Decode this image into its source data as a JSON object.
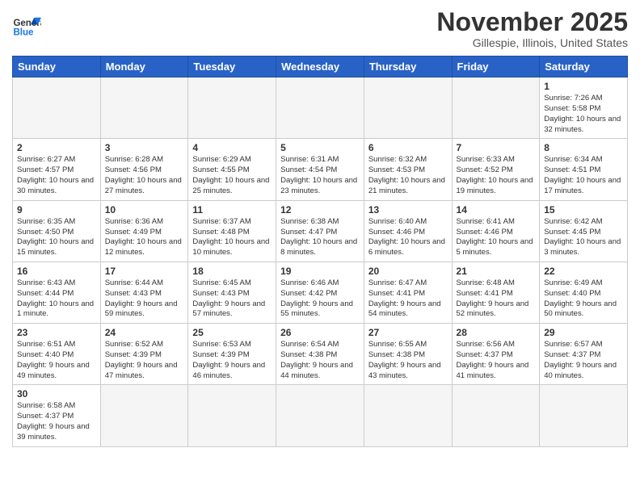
{
  "logo": {
    "text_general": "General",
    "text_blue": "Blue"
  },
  "title": "November 2025",
  "location": "Gillespie, Illinois, United States",
  "days_of_week": [
    "Sunday",
    "Monday",
    "Tuesday",
    "Wednesday",
    "Thursday",
    "Friday",
    "Saturday"
  ],
  "weeks": [
    [
      {
        "day": "",
        "info": ""
      },
      {
        "day": "",
        "info": ""
      },
      {
        "day": "",
        "info": ""
      },
      {
        "day": "",
        "info": ""
      },
      {
        "day": "",
        "info": ""
      },
      {
        "day": "",
        "info": ""
      },
      {
        "day": "1",
        "info": "Sunrise: 7:26 AM\nSunset: 5:58 PM\nDaylight: 10 hours and 32 minutes."
      }
    ],
    [
      {
        "day": "2",
        "info": "Sunrise: 6:27 AM\nSunset: 4:57 PM\nDaylight: 10 hours and 30 minutes."
      },
      {
        "day": "3",
        "info": "Sunrise: 6:28 AM\nSunset: 4:56 PM\nDaylight: 10 hours and 27 minutes."
      },
      {
        "day": "4",
        "info": "Sunrise: 6:29 AM\nSunset: 4:55 PM\nDaylight: 10 hours and 25 minutes."
      },
      {
        "day": "5",
        "info": "Sunrise: 6:31 AM\nSunset: 4:54 PM\nDaylight: 10 hours and 23 minutes."
      },
      {
        "day": "6",
        "info": "Sunrise: 6:32 AM\nSunset: 4:53 PM\nDaylight: 10 hours and 21 minutes."
      },
      {
        "day": "7",
        "info": "Sunrise: 6:33 AM\nSunset: 4:52 PM\nDaylight: 10 hours and 19 minutes."
      },
      {
        "day": "8",
        "info": "Sunrise: 6:34 AM\nSunset: 4:51 PM\nDaylight: 10 hours and 17 minutes."
      }
    ],
    [
      {
        "day": "9",
        "info": "Sunrise: 6:35 AM\nSunset: 4:50 PM\nDaylight: 10 hours and 15 minutes."
      },
      {
        "day": "10",
        "info": "Sunrise: 6:36 AM\nSunset: 4:49 PM\nDaylight: 10 hours and 12 minutes."
      },
      {
        "day": "11",
        "info": "Sunrise: 6:37 AM\nSunset: 4:48 PM\nDaylight: 10 hours and 10 minutes."
      },
      {
        "day": "12",
        "info": "Sunrise: 6:38 AM\nSunset: 4:47 PM\nDaylight: 10 hours and 8 minutes."
      },
      {
        "day": "13",
        "info": "Sunrise: 6:40 AM\nSunset: 4:46 PM\nDaylight: 10 hours and 6 minutes."
      },
      {
        "day": "14",
        "info": "Sunrise: 6:41 AM\nSunset: 4:46 PM\nDaylight: 10 hours and 5 minutes."
      },
      {
        "day": "15",
        "info": "Sunrise: 6:42 AM\nSunset: 4:45 PM\nDaylight: 10 hours and 3 minutes."
      }
    ],
    [
      {
        "day": "16",
        "info": "Sunrise: 6:43 AM\nSunset: 4:44 PM\nDaylight: 10 hours and 1 minute."
      },
      {
        "day": "17",
        "info": "Sunrise: 6:44 AM\nSunset: 4:43 PM\nDaylight: 9 hours and 59 minutes."
      },
      {
        "day": "18",
        "info": "Sunrise: 6:45 AM\nSunset: 4:43 PM\nDaylight: 9 hours and 57 minutes."
      },
      {
        "day": "19",
        "info": "Sunrise: 6:46 AM\nSunset: 4:42 PM\nDaylight: 9 hours and 55 minutes."
      },
      {
        "day": "20",
        "info": "Sunrise: 6:47 AM\nSunset: 4:41 PM\nDaylight: 9 hours and 54 minutes."
      },
      {
        "day": "21",
        "info": "Sunrise: 6:48 AM\nSunset: 4:41 PM\nDaylight: 9 hours and 52 minutes."
      },
      {
        "day": "22",
        "info": "Sunrise: 6:49 AM\nSunset: 4:40 PM\nDaylight: 9 hours and 50 minutes."
      }
    ],
    [
      {
        "day": "23",
        "info": "Sunrise: 6:51 AM\nSunset: 4:40 PM\nDaylight: 9 hours and 49 minutes."
      },
      {
        "day": "24",
        "info": "Sunrise: 6:52 AM\nSunset: 4:39 PM\nDaylight: 9 hours and 47 minutes."
      },
      {
        "day": "25",
        "info": "Sunrise: 6:53 AM\nSunset: 4:39 PM\nDaylight: 9 hours and 46 minutes."
      },
      {
        "day": "26",
        "info": "Sunrise: 6:54 AM\nSunset: 4:38 PM\nDaylight: 9 hours and 44 minutes."
      },
      {
        "day": "27",
        "info": "Sunrise: 6:55 AM\nSunset: 4:38 PM\nDaylight: 9 hours and 43 minutes."
      },
      {
        "day": "28",
        "info": "Sunrise: 6:56 AM\nSunset: 4:37 PM\nDaylight: 9 hours and 41 minutes."
      },
      {
        "day": "29",
        "info": "Sunrise: 6:57 AM\nSunset: 4:37 PM\nDaylight: 9 hours and 40 minutes."
      }
    ],
    [
      {
        "day": "30",
        "info": "Sunrise: 6:58 AM\nSunset: 4:37 PM\nDaylight: 9 hours and 39 minutes."
      },
      {
        "day": "",
        "info": ""
      },
      {
        "day": "",
        "info": ""
      },
      {
        "day": "",
        "info": ""
      },
      {
        "day": "",
        "info": ""
      },
      {
        "day": "",
        "info": ""
      },
      {
        "day": "",
        "info": ""
      }
    ]
  ]
}
